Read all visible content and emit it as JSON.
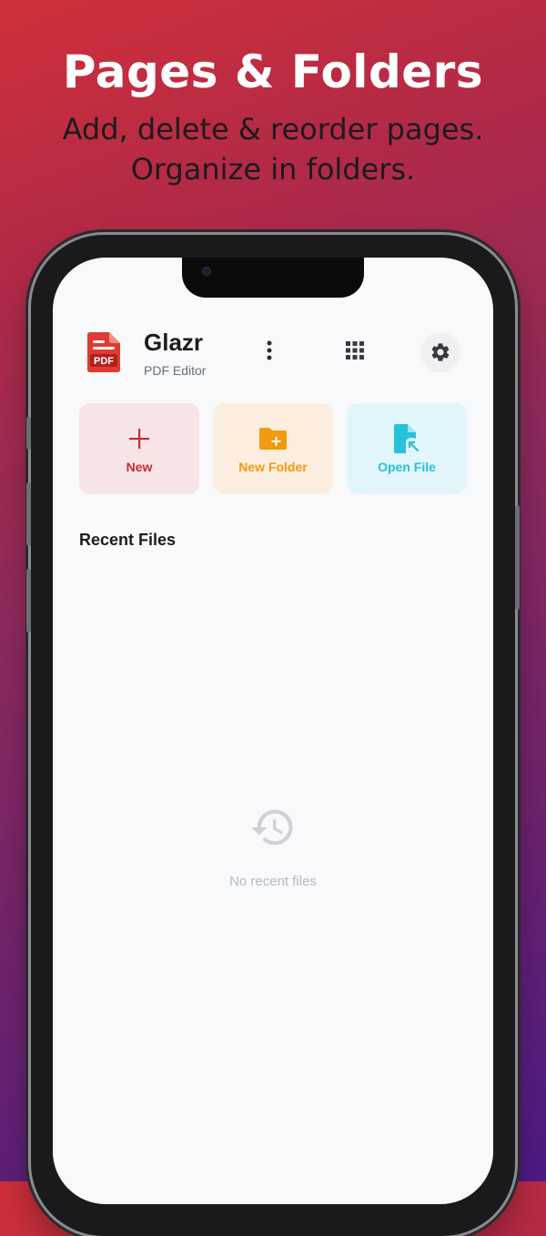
{
  "hero": {
    "title": "Pages & Folders",
    "subtitle": "Add, delete & reorder pages. Organize in folders."
  },
  "app": {
    "logo_text": "PDF",
    "name": "Glazr",
    "subtitle": "PDF Editor",
    "icons": {
      "more": "more-vertical-icon",
      "grid": "apps-grid-icon",
      "settings": "gear-icon"
    }
  },
  "actions": [
    {
      "label": "New",
      "icon": "plus-icon",
      "color": "#c62a3b"
    },
    {
      "label": "New Folder",
      "icon": "folder-add-icon",
      "color": "#f29a0e"
    },
    {
      "label": "Open File",
      "icon": "file-open-icon",
      "color": "#29c1d9"
    }
  ],
  "recent": {
    "title": "Recent Files",
    "empty_text": "No recent files",
    "empty_icon": "history-icon"
  }
}
